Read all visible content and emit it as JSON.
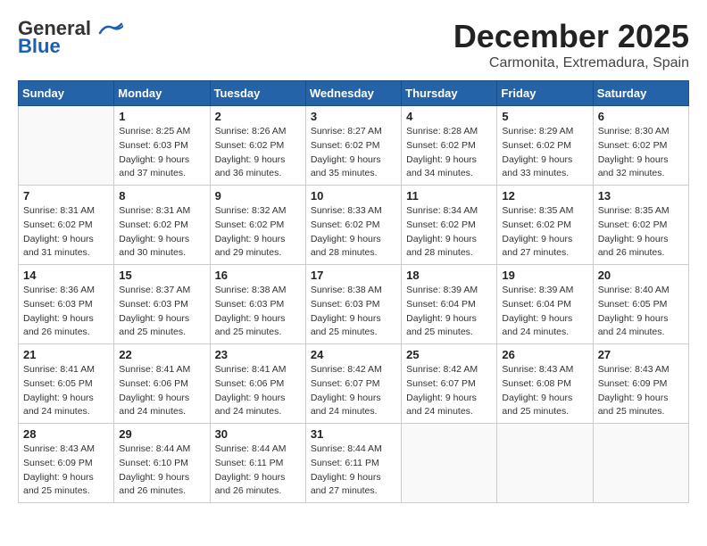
{
  "header": {
    "logo_line1": "General",
    "logo_line2": "Blue",
    "month_title": "December 2025",
    "location": "Carmonita, Extremadura, Spain"
  },
  "columns": [
    "Sunday",
    "Monday",
    "Tuesday",
    "Wednesday",
    "Thursday",
    "Friday",
    "Saturday"
  ],
  "weeks": [
    [
      {
        "day": "",
        "info": ""
      },
      {
        "day": "1",
        "info": "Sunrise: 8:25 AM\nSunset: 6:03 PM\nDaylight: 9 hours\nand 37 minutes."
      },
      {
        "day": "2",
        "info": "Sunrise: 8:26 AM\nSunset: 6:02 PM\nDaylight: 9 hours\nand 36 minutes."
      },
      {
        "day": "3",
        "info": "Sunrise: 8:27 AM\nSunset: 6:02 PM\nDaylight: 9 hours\nand 35 minutes."
      },
      {
        "day": "4",
        "info": "Sunrise: 8:28 AM\nSunset: 6:02 PM\nDaylight: 9 hours\nand 34 minutes."
      },
      {
        "day": "5",
        "info": "Sunrise: 8:29 AM\nSunset: 6:02 PM\nDaylight: 9 hours\nand 33 minutes."
      },
      {
        "day": "6",
        "info": "Sunrise: 8:30 AM\nSunset: 6:02 PM\nDaylight: 9 hours\nand 32 minutes."
      }
    ],
    [
      {
        "day": "7",
        "info": "Sunrise: 8:31 AM\nSunset: 6:02 PM\nDaylight: 9 hours\nand 31 minutes."
      },
      {
        "day": "8",
        "info": "Sunrise: 8:31 AM\nSunset: 6:02 PM\nDaylight: 9 hours\nand 30 minutes."
      },
      {
        "day": "9",
        "info": "Sunrise: 8:32 AM\nSunset: 6:02 PM\nDaylight: 9 hours\nand 29 minutes."
      },
      {
        "day": "10",
        "info": "Sunrise: 8:33 AM\nSunset: 6:02 PM\nDaylight: 9 hours\nand 28 minutes."
      },
      {
        "day": "11",
        "info": "Sunrise: 8:34 AM\nSunset: 6:02 PM\nDaylight: 9 hours\nand 28 minutes."
      },
      {
        "day": "12",
        "info": "Sunrise: 8:35 AM\nSunset: 6:02 PM\nDaylight: 9 hours\nand 27 minutes."
      },
      {
        "day": "13",
        "info": "Sunrise: 8:35 AM\nSunset: 6:02 PM\nDaylight: 9 hours\nand 26 minutes."
      }
    ],
    [
      {
        "day": "14",
        "info": "Sunrise: 8:36 AM\nSunset: 6:03 PM\nDaylight: 9 hours\nand 26 minutes."
      },
      {
        "day": "15",
        "info": "Sunrise: 8:37 AM\nSunset: 6:03 PM\nDaylight: 9 hours\nand 25 minutes."
      },
      {
        "day": "16",
        "info": "Sunrise: 8:38 AM\nSunset: 6:03 PM\nDaylight: 9 hours\nand 25 minutes."
      },
      {
        "day": "17",
        "info": "Sunrise: 8:38 AM\nSunset: 6:03 PM\nDaylight: 9 hours\nand 25 minutes."
      },
      {
        "day": "18",
        "info": "Sunrise: 8:39 AM\nSunset: 6:04 PM\nDaylight: 9 hours\nand 25 minutes."
      },
      {
        "day": "19",
        "info": "Sunrise: 8:39 AM\nSunset: 6:04 PM\nDaylight: 9 hours\nand 24 minutes."
      },
      {
        "day": "20",
        "info": "Sunrise: 8:40 AM\nSunset: 6:05 PM\nDaylight: 9 hours\nand 24 minutes."
      }
    ],
    [
      {
        "day": "21",
        "info": "Sunrise: 8:41 AM\nSunset: 6:05 PM\nDaylight: 9 hours\nand 24 minutes."
      },
      {
        "day": "22",
        "info": "Sunrise: 8:41 AM\nSunset: 6:06 PM\nDaylight: 9 hours\nand 24 minutes."
      },
      {
        "day": "23",
        "info": "Sunrise: 8:41 AM\nSunset: 6:06 PM\nDaylight: 9 hours\nand 24 minutes."
      },
      {
        "day": "24",
        "info": "Sunrise: 8:42 AM\nSunset: 6:07 PM\nDaylight: 9 hours\nand 24 minutes."
      },
      {
        "day": "25",
        "info": "Sunrise: 8:42 AM\nSunset: 6:07 PM\nDaylight: 9 hours\nand 24 minutes."
      },
      {
        "day": "26",
        "info": "Sunrise: 8:43 AM\nSunset: 6:08 PM\nDaylight: 9 hours\nand 25 minutes."
      },
      {
        "day": "27",
        "info": "Sunrise: 8:43 AM\nSunset: 6:09 PM\nDaylight: 9 hours\nand 25 minutes."
      }
    ],
    [
      {
        "day": "28",
        "info": "Sunrise: 8:43 AM\nSunset: 6:09 PM\nDaylight: 9 hours\nand 25 minutes."
      },
      {
        "day": "29",
        "info": "Sunrise: 8:44 AM\nSunset: 6:10 PM\nDaylight: 9 hours\nand 26 minutes."
      },
      {
        "day": "30",
        "info": "Sunrise: 8:44 AM\nSunset: 6:11 PM\nDaylight: 9 hours\nand 26 minutes."
      },
      {
        "day": "31",
        "info": "Sunrise: 8:44 AM\nSunset: 6:11 PM\nDaylight: 9 hours\nand 27 minutes."
      },
      {
        "day": "",
        "info": ""
      },
      {
        "day": "",
        "info": ""
      },
      {
        "day": "",
        "info": ""
      }
    ]
  ]
}
